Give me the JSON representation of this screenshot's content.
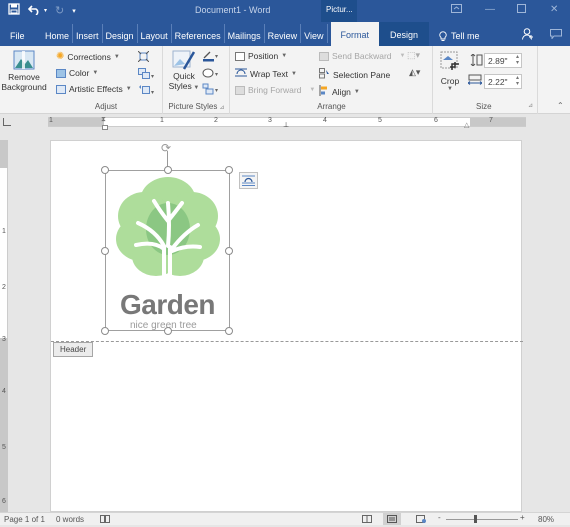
{
  "titlebar": {
    "document_title": "Document1 - Word",
    "context_tab": "Pictur...",
    "qat": {
      "save": "save-icon",
      "undo": "undo-icon",
      "redo": "redo-icon",
      "customize": "customize-qat-icon"
    },
    "window_controls": [
      "ribbon-display-options",
      "minimize",
      "maximize",
      "close"
    ]
  },
  "tabs": [
    {
      "label": "File"
    },
    {
      "label": "Home"
    },
    {
      "label": "Insert"
    },
    {
      "label": "Design"
    },
    {
      "label": "Layout"
    },
    {
      "label": "References"
    },
    {
      "label": "Mailings"
    },
    {
      "label": "Review"
    },
    {
      "label": "View"
    },
    {
      "label": "Format",
      "active": true
    },
    {
      "label": "Design"
    },
    {
      "label": "Tell me"
    }
  ],
  "ribbon": {
    "remove_background": {
      "line1": "Remove",
      "line2": "Background"
    },
    "adjust": {
      "label": "Adjust",
      "corrections": "Corrections",
      "color": "Color",
      "artistic_effects": "Artistic Effects"
    },
    "picture_styles": {
      "label": "Picture Styles",
      "quick_styles_line1": "Quick",
      "quick_styles_line2": "Styles"
    },
    "arrange": {
      "label": "Arrange",
      "position": "Position",
      "wrap_text": "Wrap Text",
      "bring_forward": "Bring Forward",
      "send_backward": "Send Backward",
      "selection_pane": "Selection Pane",
      "align": "Align"
    },
    "size": {
      "label": "Size",
      "crop": "Crop",
      "height": "2.89\"",
      "width": "2.22\""
    }
  },
  "ruler": {
    "h_numbers": [
      "1",
      "1",
      "2",
      "3",
      "4",
      "5",
      "6",
      "7"
    ],
    "v_numbers": [
      "1",
      "2",
      "3",
      "4",
      "5",
      "6"
    ]
  },
  "document": {
    "header_tag": "Header",
    "image_title": "Garden",
    "image_subtitle": "nice green tree"
  },
  "statusbar": {
    "page": "Page 1 of 1",
    "words": "0 words",
    "zoom": "80%"
  },
  "colors": {
    "accent": "#2b579a",
    "ribbon_bg": "#f3f3f3",
    "leaf_green": "#5cb531"
  }
}
